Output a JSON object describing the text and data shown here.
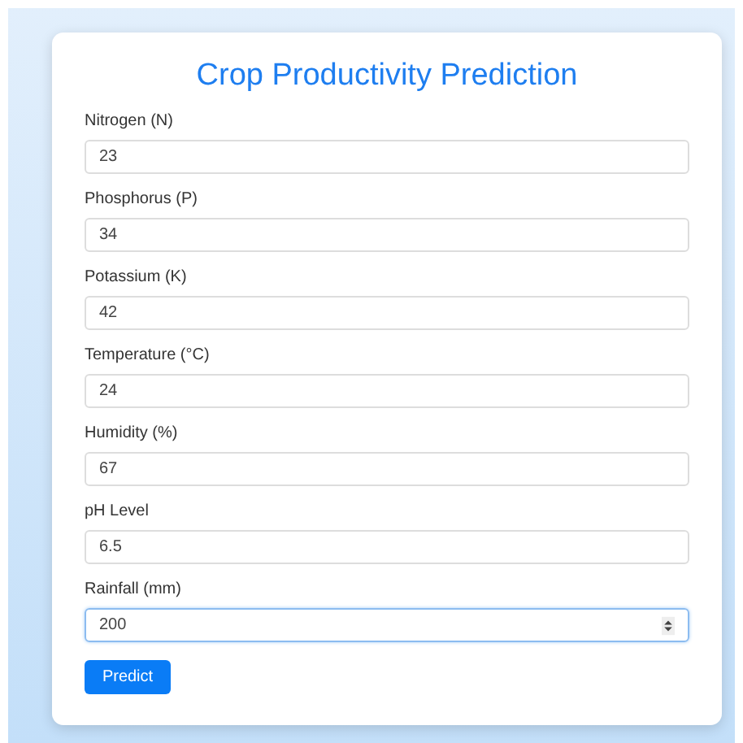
{
  "title": "Crop Productivity Prediction",
  "fields": [
    {
      "label": "Nitrogen (N)",
      "value": "23",
      "focused": false
    },
    {
      "label": "Phosphorus (P)",
      "value": "34",
      "focused": false
    },
    {
      "label": "Potassium (K)",
      "value": "42",
      "focused": false
    },
    {
      "label": "Temperature (°C)",
      "value": "24",
      "focused": false
    },
    {
      "label": "Humidity (%)",
      "value": "67",
      "focused": false
    },
    {
      "label": "pH Level",
      "value": "6.5",
      "focused": false
    },
    {
      "label": "Rainfall (mm)",
      "value": "200",
      "focused": true
    }
  ],
  "submit": "Predict"
}
